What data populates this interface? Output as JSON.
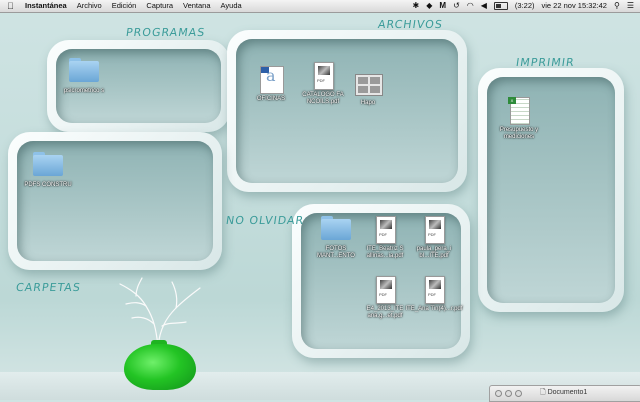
{
  "menubar": {
    "app": "Instantánea",
    "items": [
      "Archivo",
      "Edición",
      "Captura",
      "Ventana",
      "Ayuda"
    ],
    "battery_time": "(3:22)",
    "clock": "vie 22 nov  15:32:42"
  },
  "labels": {
    "programas": "PROGRAMAS",
    "archivos": "ARCHIVOS",
    "imprimir": "IMPRIMIR",
    "no_olvidar": "NO OLVIDAR",
    "carpetas": "CARPETAS"
  },
  "icons": {
    "psicrometricos": "psicrometrico s",
    "pdfs": "PDFS CONSTRU",
    "oficinas": "OFICINAS",
    "catalogo": "CATALOGO FA NCOILS.pdf",
    "hapo": "Hapo",
    "presupuesto": "Presupuesto y mediciones",
    "fotos": "FOTOS MANT...ENTO",
    "ite_beatriz": "ITE_Beatriz S allinas...ia.pdf",
    "paula": "paula_pera_i bI...ITE.pdf",
    "e4": "E4_2013_ITE ana.g...et.pdf",
    "ite_ana": "ITE_Ana Tin(4)...r.pdf"
  },
  "doc_tag": "PDF",
  "docwin": {
    "title": "Documento1"
  }
}
